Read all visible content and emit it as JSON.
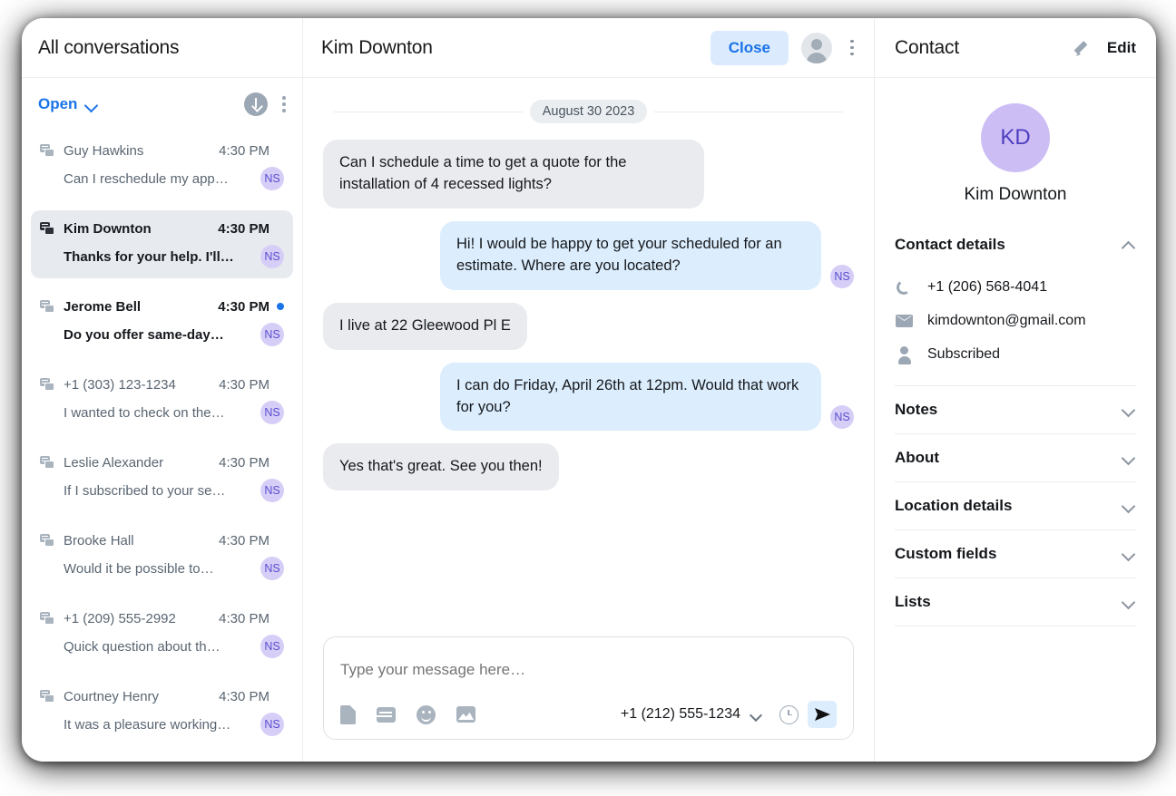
{
  "left": {
    "header_title": "All conversations",
    "filter_label": "Open",
    "download_icon": "download-circle-icon",
    "menu_icon": "kebab-menu-icon",
    "conversations": [
      {
        "name": "Guy Hawkins",
        "time": "4:30 PM",
        "preview": "Can I reschedule my app…",
        "avatar": "NS",
        "unread": false,
        "selected": false,
        "dot": false
      },
      {
        "name": "Kim Downton",
        "time": "4:30 PM",
        "preview": "Thanks for your help. I'll…",
        "avatar": "NS",
        "unread": false,
        "selected": true,
        "dot": false
      },
      {
        "name": "Jerome Bell",
        "time": "4:30 PM",
        "preview": "Do you offer same-day…",
        "avatar": "NS",
        "unread": true,
        "selected": false,
        "dot": true
      },
      {
        "name": "+1 (303) 123-1234",
        "time": "4:30 PM",
        "preview": "I wanted to check on the…",
        "avatar": "NS",
        "unread": false,
        "selected": false,
        "dot": false
      },
      {
        "name": "Leslie Alexander",
        "time": "4:30 PM",
        "preview": "If I subscribed to your se…",
        "avatar": "NS",
        "unread": false,
        "selected": false,
        "dot": false
      },
      {
        "name": "Brooke Hall",
        "time": "4:30 PM",
        "preview": "Would it be possible to…",
        "avatar": "NS",
        "unread": false,
        "selected": false,
        "dot": false
      },
      {
        "name": "+1 (209) 555-2992",
        "time": "4:30 PM",
        "preview": "Quick question about th…",
        "avatar": "NS",
        "unread": false,
        "selected": false,
        "dot": false
      },
      {
        "name": "Courtney Henry",
        "time": "4:30 PM",
        "preview": "It was a pleasure working…",
        "avatar": "NS",
        "unread": false,
        "selected": false,
        "dot": false
      }
    ]
  },
  "center": {
    "header_title": "Kim Downton",
    "close_label": "Close",
    "date_divider": "August 30 2023",
    "messages": [
      {
        "direction": "in",
        "text": "Can I schedule a time to get a quote for the installation of 4 recessed lights?",
        "avatar": ""
      },
      {
        "direction": "out",
        "text": "Hi! I would be happy to get your scheduled for an estimate. Where are you located?",
        "avatar": "NS"
      },
      {
        "direction": "in",
        "text": "I live at 22 Gleewood Pl E",
        "avatar": ""
      },
      {
        "direction": "out",
        "text": "I can do Friday, April 26th at 12pm. Would that work for you?",
        "avatar": "NS"
      },
      {
        "direction": "in",
        "text": "Yes that's great. See you then!",
        "avatar": ""
      }
    ],
    "composer": {
      "placeholder": "Type your message here…",
      "value": "",
      "from_number": "+1 (212) 555-1234",
      "icons": [
        "file-icon",
        "template-icon",
        "emoji-icon",
        "image-icon"
      ],
      "schedule_icon": "clock-icon",
      "send_icon": "send-icon"
    }
  },
  "right": {
    "header_title": "Contact",
    "edit_label": "Edit",
    "avatar_initials": "KD",
    "contact_name": "Kim Downton",
    "sections": [
      {
        "title": "Contact details",
        "expanded": true
      },
      {
        "title": "Notes",
        "expanded": false
      },
      {
        "title": "About",
        "expanded": false
      },
      {
        "title": "Location details",
        "expanded": false
      },
      {
        "title": "Custom fields",
        "expanded": false
      },
      {
        "title": "Lists",
        "expanded": false
      }
    ],
    "details": [
      {
        "icon": "phone-icon",
        "value": "+1 (206) 568-4041"
      },
      {
        "icon": "mail-icon",
        "value": "kimdownton@gmail.com"
      },
      {
        "icon": "person-icon",
        "value": "Subscribed"
      }
    ]
  },
  "colors": {
    "accent_blue": "#1A73E8",
    "close_bg": "#DBEBFD",
    "bubble_in": "#E9EBEE",
    "bubble_out": "#DCEDFD",
    "avatar_purple": "#D6CEF7",
    "selected_row": "#E7EBEF"
  }
}
